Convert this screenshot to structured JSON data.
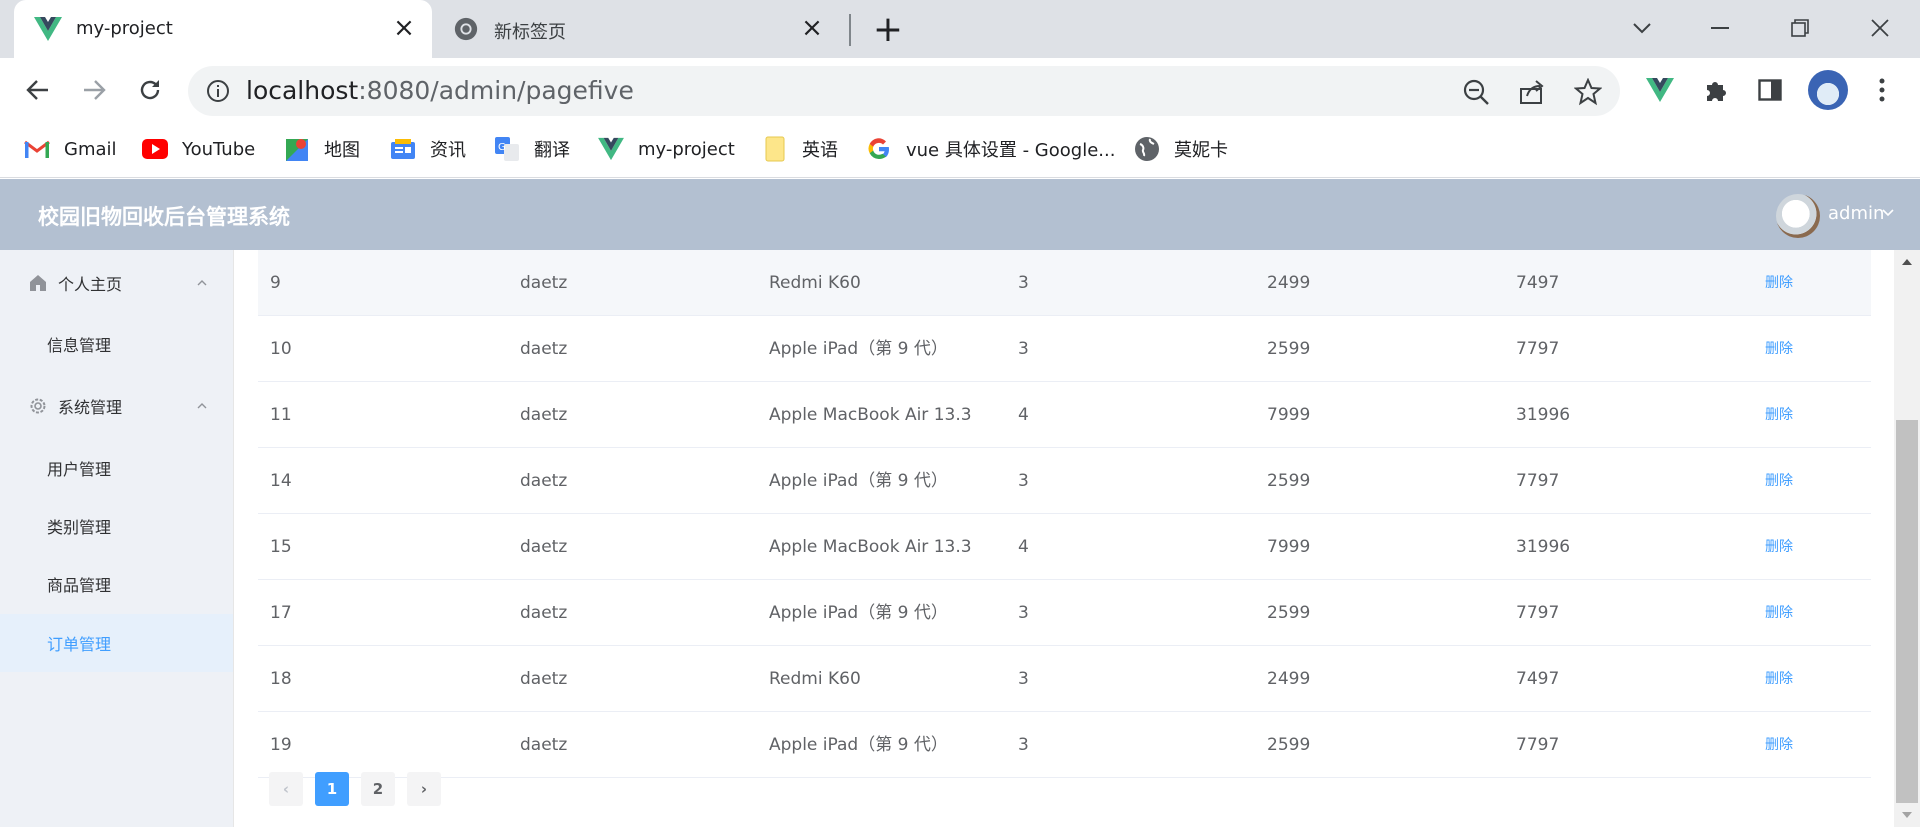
{
  "browser": {
    "tabs": [
      {
        "title": "my-project",
        "icon": "vue-icon"
      },
      {
        "title": "新标签页",
        "icon": "chrome-icon"
      }
    ],
    "url_host": "localhost",
    "url_rest": ":8080/admin/pagefive",
    "bookmarks": [
      {
        "label": "Gmail",
        "icon": "gmail-icon"
      },
      {
        "label": "YouTube",
        "icon": "youtube-icon"
      },
      {
        "label": "地图",
        "icon": "maps-icon"
      },
      {
        "label": "资讯",
        "icon": "news-icon"
      },
      {
        "label": "翻译",
        "icon": "translate-icon"
      },
      {
        "label": "my-project",
        "icon": "vue-icon"
      },
      {
        "label": "英语",
        "icon": "folder-icon"
      },
      {
        "label": "vue 具体设置 - Google...",
        "icon": "google-icon"
      },
      {
        "label": "莫妮卡",
        "icon": "globe-icon"
      }
    ]
  },
  "header": {
    "title": "校园旧物回收后台管理系统",
    "user": "admin"
  },
  "sidebar": {
    "groups": [
      {
        "label": "个人主页",
        "icon": "home-icon",
        "items": [
          {
            "label": "信息管理"
          }
        ]
      },
      {
        "label": "系统管理",
        "icon": "gear-icon",
        "items": [
          {
            "label": "用户管理"
          },
          {
            "label": "类别管理"
          },
          {
            "label": "商品管理"
          },
          {
            "label": "订单管理"
          }
        ]
      }
    ]
  },
  "table": {
    "rows": [
      {
        "id": "9",
        "user": "daetz",
        "product": "Redmi K60",
        "qty": "3",
        "price": "2499",
        "total": "7497",
        "action": "删除"
      },
      {
        "id": "10",
        "user": "daetz",
        "product": "Apple iPad（第 9 代）",
        "qty": "3",
        "price": "2599",
        "total": "7797",
        "action": "删除"
      },
      {
        "id": "11",
        "user": "daetz",
        "product": "Apple MacBook Air 13.3",
        "qty": "4",
        "price": "7999",
        "total": "31996",
        "action": "删除"
      },
      {
        "id": "14",
        "user": "daetz",
        "product": "Apple iPad（第 9 代）",
        "qty": "3",
        "price": "2599",
        "total": "7797",
        "action": "删除"
      },
      {
        "id": "15",
        "user": "daetz",
        "product": "Apple MacBook Air 13.3",
        "qty": "4",
        "price": "7999",
        "total": "31996",
        "action": "删除"
      },
      {
        "id": "17",
        "user": "daetz",
        "product": "Apple iPad（第 9 代）",
        "qty": "3",
        "price": "2599",
        "total": "7797",
        "action": "删除"
      },
      {
        "id": "18",
        "user": "daetz",
        "product": "Redmi K60",
        "qty": "3",
        "price": "2499",
        "total": "7497",
        "action": "删除"
      },
      {
        "id": "19",
        "user": "daetz",
        "product": "Apple iPad（第 9 代）",
        "qty": "3",
        "price": "2599",
        "total": "7797",
        "action": "删除"
      }
    ]
  },
  "pagination": {
    "prev": "‹",
    "pages": [
      "1",
      "2"
    ],
    "current": "1",
    "next": "›"
  },
  "colors": {
    "accent": "#409eff",
    "header_bg": "#b3c0d1",
    "sidebar_bg": "#eef1f6"
  }
}
